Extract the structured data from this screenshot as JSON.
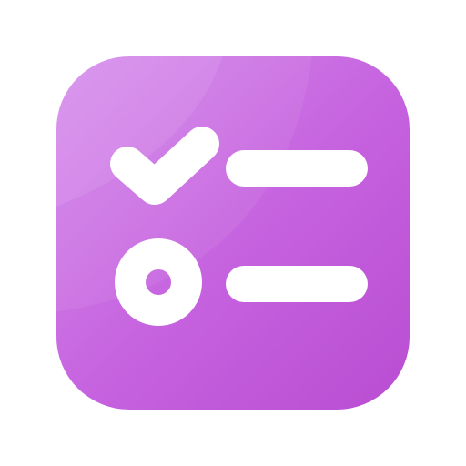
{
  "icon": {
    "name": "checklist-icon",
    "tile_gradient": [
      "#d58bec",
      "#c561de",
      "#b94dd2"
    ],
    "glyph_color": "#ffffff",
    "rows": [
      {
        "state": "checked",
        "marker_icon": "checkmark-icon"
      },
      {
        "state": "unchecked",
        "marker_icon": "ring-icon"
      }
    ]
  }
}
